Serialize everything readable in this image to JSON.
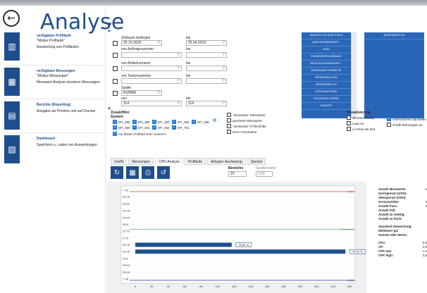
{
  "app": {
    "title": "Analyse"
  },
  "sidebar": {
    "items": [
      {
        "icon": "bar-chart-icon",
        "title": "verfügbare Prüfläufe",
        "sub": "\"Modus Prüfläufe\"",
        "desc": "Auswertung von Prüfläufen"
      },
      {
        "icon": "measurement-icon",
        "title": "verfügbare Messungen",
        "sub": "\"Modus Messungen\"",
        "desc": "Messwert-Analyse einzelner Messungen"
      },
      {
        "icon": "report-icon",
        "title": "Berichte (Reporting)",
        "sub": "",
        "desc": "Ausgabe als Preview und auf Drucker"
      },
      {
        "icon": "dashboard-icon",
        "title": "Dashboard",
        "sub": "",
        "desc": "Speichern u. Laden von Auswertungen"
      }
    ]
  },
  "filters": {
    "zeitraum_label": "Zeitraum festlegen",
    "von_date": "25.10.2018",
    "bis_label": "bis",
    "bis_date": "25.04.2019",
    "auftrag_label": "von Auftragsnummer",
    "artikel_label": "von Artikelnummer",
    "serien_label": "von Seriennummer",
    "spalte_label": "Spalte",
    "spalte_value": "RUNNR",
    "von_label": "von",
    "von_value": "114",
    "bis_value": "114"
  },
  "param_list": [
    "INDUCED VOLTAGE STAUS",
    "LINKS AUSSENFUHRT...",
    "DF4D",
    "PHASENVERSCHIEBUNG",
    "RECHTS AUSSENFUHRT...",
    "RESISTANCE SYMMETRI",
    "RESISTANCE U/W",
    "RESISTANCE V/U",
    "ROTATION SPEED",
    "ROTATIONAL SPEED",
    "RUNLEFT"
  ],
  "selected_list": [
    "RESISTANCE V/U"
  ],
  "zusatzfilter": {
    "title": "Zusatzfilter",
    "subtitle": "System",
    "systems": [
      "MT_380",
      "MT_382",
      "MT_383",
      "MT_384",
      "MT_389",
      "MT_480",
      "MT_481",
      "MT_482",
      "MT_701"
    ],
    "last_run_label": "nur letzten Prüflauf einer Seriennr.",
    "options": [
      "\"versteckte\" Messwerte",
      "ignorierte Messwerte",
      "\"versteckte\" Prüfschritte",
      "leere Grenzwerte"
    ]
  },
  "visualisierung": {
    "title": "Visualisierung",
    "options": [
      "3D-Darstellung",
      "Lupe an",
      "x-Achse als Zeit"
    ],
    "right_options": [
      "min/max/med darstellen",
      "Grafik-Warnungen an"
    ]
  },
  "tabs": [
    "Grafik",
    "Messungen",
    "CPK-Analyse",
    "Prüfläufe",
    "Anlagen-Auslastung",
    "Spezial"
  ],
  "bereiche": {
    "label": "Bereiche",
    "value": "10",
    "spaltenweite_label": "Spaltenweite",
    "spaltenweite_value": "0,50"
  },
  "chart_data": {
    "type": "bar",
    "orientation": "horizontal",
    "categories": [
      "> 30",
      "29.76",
      "29.52",
      "29.28",
      "29.04",
      "28.8",
      "28.56",
      "28.32",
      "28.08",
      "27.84",
      "< 28"
    ],
    "y_ticks": [
      "> 30",
      "29.76",
      "29.52",
      "29.28",
      "29.04",
      "28.8",
      "27.72",
      "27.5",
      "26.76",
      "26.28",
      "25.8",
      "25.52",
      "25.28",
      "< 28"
    ],
    "values": [
      0,
      0,
      0,
      0,
      0,
      0,
      0,
      0,
      117,
      255,
      0
    ],
    "bars": [
      {
        "category": "26.76",
        "value": 117,
        "label": "29,86 %"
      },
      {
        "category": "26.28",
        "value": 255,
        "label": "70,05 %"
      }
    ],
    "xlim": [
      0,
      260
    ],
    "x_ticks": [
      "0",
      "20",
      "40",
      "60",
      "80",
      "100",
      "120",
      "140",
      "160",
      "180",
      "200",
      "220",
      "240",
      "260"
    ],
    "limit_lines": [
      {
        "name": "OSG",
        "color": "#e53935"
      },
      {
        "name": "Grenzwert",
        "color": "#43a047"
      },
      {
        "name": "USG",
        "color": "#1e3a8a"
      }
    ],
    "bar_color": "#1f4e8c"
  },
  "stats": {
    "rows": [
      {
        "k": "Anzahl Messwerte:",
        "v": "1"
      },
      {
        "k": "Untergrenze (USG):",
        "v": ""
      },
      {
        "k": "Obergrenze (OSG):",
        "v": ""
      },
      {
        "k": "Grenzenmitte:",
        "v": "2"
      },
      {
        "k": "Anzahl Pass:",
        "v": "3"
      },
      {
        "k": "Anzahl Fail:",
        "v": ""
      },
      {
        "k": "Anzahl zu niedrig:",
        "v": ""
      },
      {
        "k": "Anzahl zu hoch:",
        "v": ""
      }
    ],
    "rows2": [
      {
        "k": "Standard Abweichung:",
        "v": ""
      },
      {
        "k": "Mittelwert (µ):",
        "v": ""
      },
      {
        "k": "Summe aller Werte..",
        "v": ""
      }
    ],
    "rows3": [
      {
        "k": "CPo:",
        "v": "0,5"
      },
      {
        "k": "CP:",
        "v": "0,5"
      },
      {
        "k": "CPK low:",
        "v": "1,4"
      },
      {
        "k": "CPK high:",
        "v": "3,5"
      }
    ]
  }
}
